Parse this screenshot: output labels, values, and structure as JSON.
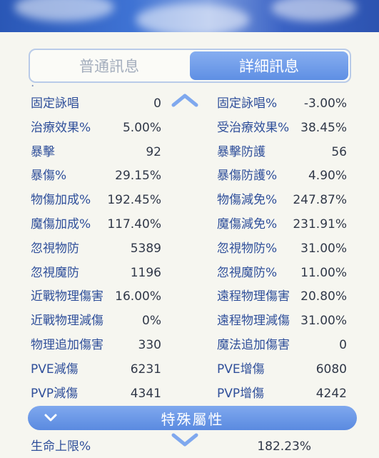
{
  "tabs": {
    "normal": "普通訊息",
    "detail": "詳細訊息"
  },
  "stats": [
    {
      "left_label": "固定詠唱",
      "left_value": "0",
      "right_label": "固定詠唱%",
      "right_value": "-3.00%"
    },
    {
      "left_label": "治療效果%",
      "left_value": "5.00%",
      "right_label": "受治療效果%",
      "right_value": "38.45%"
    },
    {
      "left_label": "暴擊",
      "left_value": "92",
      "right_label": "暴擊防護",
      "right_value": "56"
    },
    {
      "left_label": "暴傷%",
      "left_value": "29.15%",
      "right_label": "暴傷防護%",
      "right_value": "4.90%"
    },
    {
      "left_label": "物傷加成%",
      "left_value": "192.45%",
      "right_label": "物傷減免%",
      "right_value": "247.87%"
    },
    {
      "left_label": "魔傷加成%",
      "left_value": "117.40%",
      "right_label": "魔傷減免%",
      "right_value": "231.91%"
    },
    {
      "left_label": "忽視物防",
      "left_value": "5389",
      "right_label": "忽視物防%",
      "right_value": "31.00%"
    },
    {
      "left_label": "忽視魔防",
      "left_value": "1196",
      "right_label": "忽視魔防%",
      "right_value": "11.00%"
    },
    {
      "left_label": "近戰物理傷害",
      "left_value": "16.00%",
      "right_label": "遠程物理傷害",
      "right_value": "20.80%"
    },
    {
      "left_label": "近戰物理減傷",
      "left_value": "0%",
      "right_label": "遠程物理減傷",
      "right_value": "31.00%"
    },
    {
      "left_label": "物理追加傷害",
      "left_value": "330",
      "right_label": "魔法追加傷害",
      "right_value": "0"
    },
    {
      "left_label": "PVE減傷",
      "left_value": "6231",
      "right_label": "PVE增傷",
      "right_value": "6080"
    },
    {
      "left_label": "PVP減傷",
      "left_value": "4341",
      "right_label": "PVP增傷",
      "right_value": "4242"
    }
  ],
  "section": {
    "title": "特殊屬性"
  },
  "next_row": {
    "left_label": "生命上限%",
    "right_value": "182.23%"
  },
  "colors": {
    "accent": "#6a96e6",
    "label": "#2f4f9a",
    "value": "#303848"
  },
  "icons": {
    "scroll_up": "chevron-up-icon",
    "scroll_down": "chevron-down-icon",
    "section_toggle": "chevron-down-icon"
  }
}
